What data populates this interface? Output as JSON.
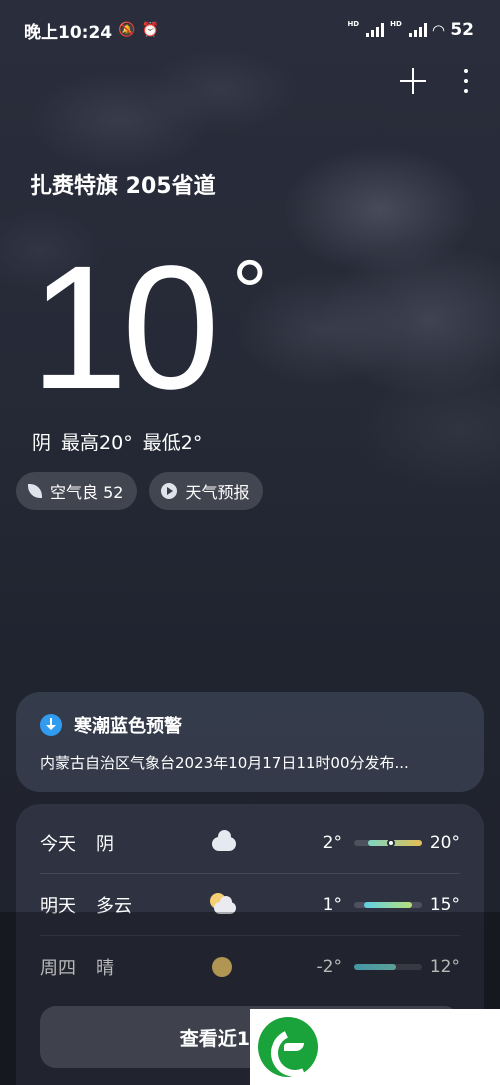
{
  "status_bar": {
    "time": "晚上10:24",
    "battery": "52",
    "hd1": "HD",
    "hd2": "HD"
  },
  "location": "扎赉特旗 205省道",
  "current": {
    "temp": "10",
    "deg_symbol": "°",
    "condition": "阴  最高20° 最低2°"
  },
  "chips": {
    "air_quality": "空气良 52",
    "forecast": "天气预报"
  },
  "alert": {
    "title": "寒潮蓝色预警",
    "text": "内蒙古自治区气象台2023年10月17日11时00分发布..."
  },
  "forecast": [
    {
      "day": "今天",
      "condition": "阴",
      "icon": "cloud-icon",
      "low": "2°",
      "high": "20°",
      "range_start": 0.2,
      "range_end": 1.0,
      "current_marker": 0.55,
      "fill_color": "#7dd7c2",
      "fill_color2": "#e5be52"
    },
    {
      "day": "明天",
      "condition": "多云",
      "icon": "partly-cloudy-icon",
      "low": "1°",
      "high": "15°",
      "range_start": 0.15,
      "range_end": 0.85,
      "fill_color": "#5fd0e6",
      "fill_color2": "#b8e07a"
    },
    {
      "day": "周四",
      "condition": "晴",
      "icon": "sun-icon",
      "low": "-2°",
      "high": "12°",
      "range_start": 0.0,
      "range_end": 0.62,
      "fill_color": "#5fcfe8",
      "fill_color2": "#7fe0d0"
    }
  ],
  "bottom_button": "查看近15日天气",
  "colors": {
    "background": "#262a37",
    "alert_icon": "#2f9cf0",
    "sun": "#f6cf74",
    "logo_green": "#1aa33a"
  }
}
